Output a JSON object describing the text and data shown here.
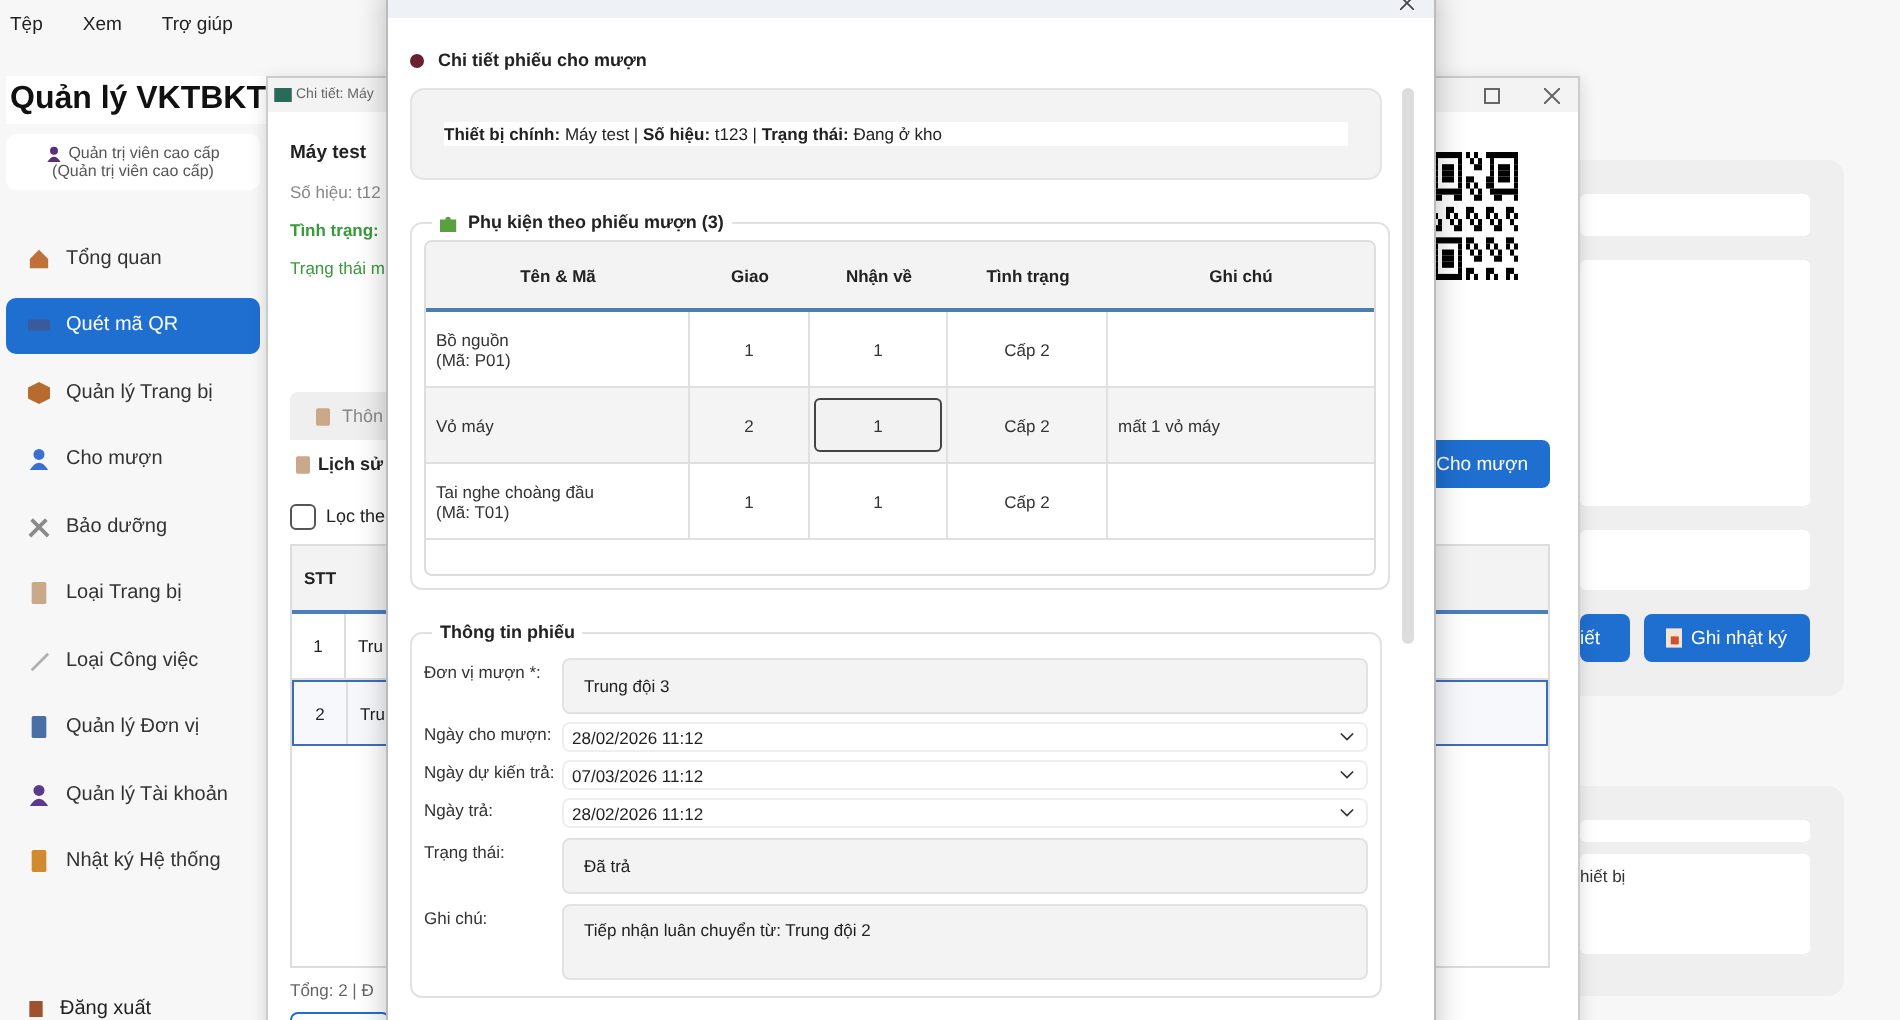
{
  "menu_bar": [
    {
      "label": "Tệp"
    },
    {
      "label": "Xem"
    },
    {
      "label": "Trợ giúp"
    }
  ],
  "sidebar": {
    "title": "Quản lý VKTBKT",
    "user": {
      "name": "Quản trị viên cao cấp",
      "role": "(Quản trị viên cao cấp)"
    },
    "items": [
      {
        "label": "Tổng quan",
        "selected": false
      },
      {
        "label": "Quét mã QR",
        "selected": true
      },
      {
        "label": "Quản lý Trang bị",
        "selected": false
      },
      {
        "label": "Cho mượn",
        "selected": false
      },
      {
        "label": "Bảo dưỡng",
        "selected": false
      },
      {
        "label": "Loại Trang bị",
        "selected": false
      },
      {
        "label": "Loại Công việc",
        "selected": false
      },
      {
        "label": "Quản lý Đơn vị",
        "selected": false
      },
      {
        "label": "Quản lý Tài khoản",
        "selected": false
      },
      {
        "label": "Nhật ký Hệ thống",
        "selected": false
      }
    ],
    "logout": "Đăng xuất"
  },
  "background_panel": {
    "buttons": [
      {
        "label": "iết"
      },
      {
        "label": "Ghi nhật ký"
      }
    ],
    "list_text": "hiết bị"
  },
  "detail_window": {
    "title": "Chi tiết: Máy",
    "device_name": "Máy test",
    "serial": "Số hiệu: t12",
    "condition_label": "Tình trạng:",
    "status_text": "Trạng thái m",
    "tab": "Thôn",
    "history_title": "Lịch sử",
    "lend_button": "Cho mượn",
    "filter": {
      "label": "Lọc the",
      "checked": false
    },
    "table": {
      "columns": [
        "STT"
      ],
      "rows": [
        {
          "no": "1",
          "unit": "Tru",
          "selected": false
        },
        {
          "no": "2",
          "unit": "Tru",
          "selected": true
        }
      ]
    },
    "total": "Tổng: 2 | Đ"
  },
  "dialog": {
    "heading": "Chi tiết phiếu cho mượn",
    "summary": "**Thiết bị chính:** Máy test | **Số hiệu:** t123 | **Trạng thái:** Đang ở kho",
    "accessories": {
      "title": "Phụ kiện theo phiếu mượn (3)",
      "columns": [
        "Tên & Mã",
        "Giao",
        "Nhận về",
        "Tình trạng",
        "Ghi chú"
      ],
      "rows": [
        {
          "name": "Bồ nguồn",
          "code": "(Mã: P01)",
          "delivered": "1",
          "received": "1",
          "condition": "Cấp 2",
          "editing": false
        },
        {
          "name": "Vỏ máy",
          "delivered": "2",
          "received": "1",
          "condition": "Cấp 2",
          "note": "mất 1 vỏ máy",
          "editing": true
        },
        {
          "name": "Tai nghe choàng đầu",
          "code": "(Mã: T01)",
          "delivered": "1",
          "received": "1",
          "condition": "Cấp 2",
          "editing": false
        }
      ]
    },
    "info": {
      "title": "Thông tin phiếu",
      "fields": [
        {
          "kind": "text",
          "label": "Đơn vị mượn *:",
          "value": "Trung đội 3"
        },
        {
          "kind": "date",
          "label": "Ngày cho mượn:",
          "value": "28/02/2026 11:12"
        },
        {
          "kind": "date",
          "label": "Ngày dự kiến trả:",
          "value": "07/03/2026 11:12"
        },
        {
          "kind": "date",
          "label": "Ngày trả:",
          "value": "28/02/2026 11:12"
        },
        {
          "kind": "text",
          "label": "Trạng thái:",
          "value": "Đã trả"
        },
        {
          "kind": "multiline",
          "label": "Ghi chú:",
          "value": "Tiếp nhận luân chuyển từ: Trung đội 2"
        }
      ]
    }
  }
}
